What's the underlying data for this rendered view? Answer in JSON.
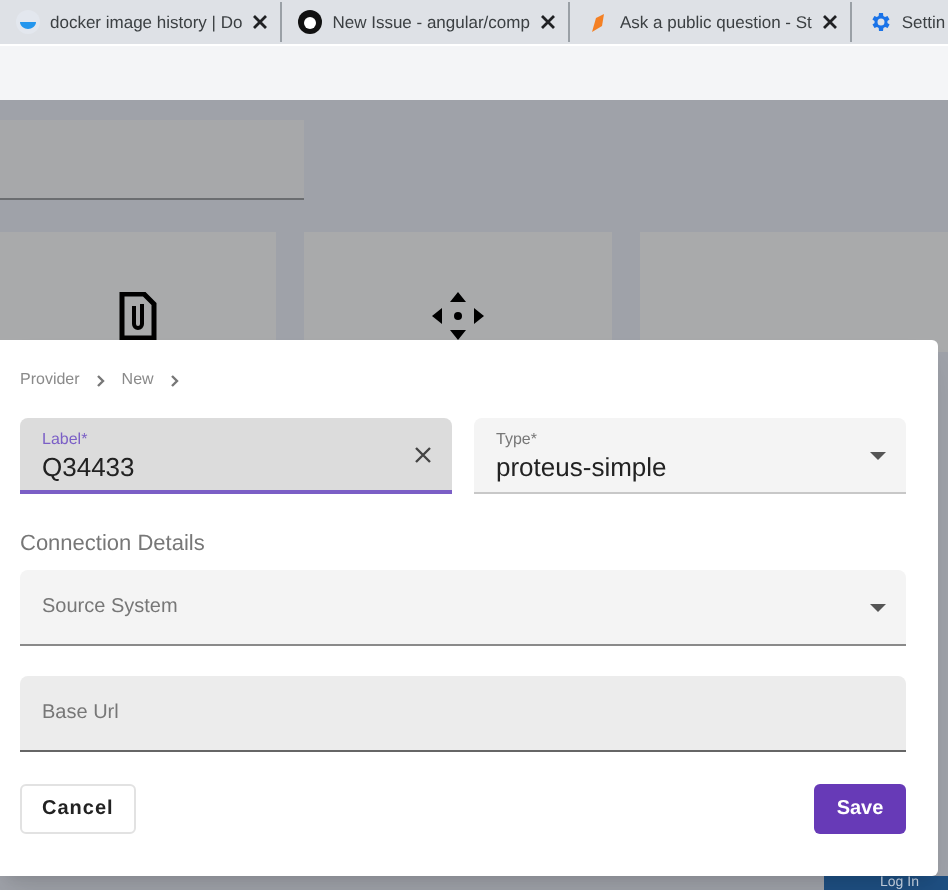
{
  "browser_tabs": [
    {
      "title": "docker image history | Do",
      "selected": false
    },
    {
      "title": "New Issue - angular/comp",
      "selected": false
    },
    {
      "title": "Ask a public question - St",
      "selected": false
    },
    {
      "title": "Settin",
      "selected": false
    }
  ],
  "background": {
    "login_button": "Log In"
  },
  "dialog": {
    "breadcrumb": [
      "Provider",
      "New"
    ],
    "label_field": {
      "label": "Label*",
      "value": "Q34433",
      "focused": true
    },
    "type_field": {
      "label": "Type*",
      "value": "proteus-simple"
    },
    "section_title": "Connection Details",
    "source_system": {
      "placeholder": "Source System"
    },
    "base_url": {
      "placeholder": "Base Url"
    },
    "cancel": "Cancel",
    "save": "Save"
  }
}
